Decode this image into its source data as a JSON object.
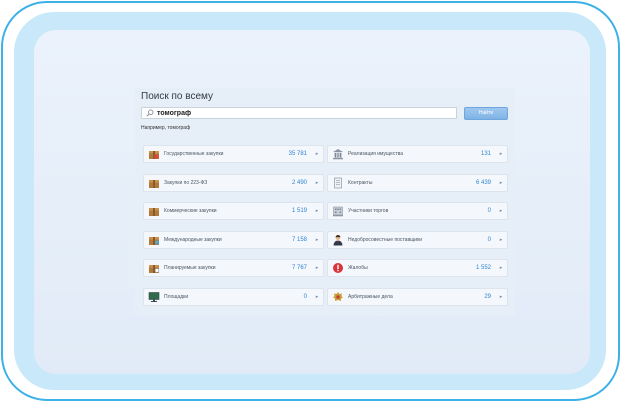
{
  "search": {
    "title": "Поиск по всему",
    "query": "томограф",
    "button_label": "Найти",
    "hint_prefix": "Например,",
    "hint_example": "томограф"
  },
  "categories": [
    {
      "label": "Государственные закупки",
      "count": "35 781",
      "icon": "box-icon"
    },
    {
      "label": "Реализация имущества",
      "count": "131",
      "icon": "building-icon"
    },
    {
      "label": "Закупки по 223-ФЗ",
      "count": "2 490",
      "icon": "box-icon"
    },
    {
      "label": "Контракты",
      "count": "6 439",
      "icon": "document-icon"
    },
    {
      "label": "Коммерческие закупки",
      "count": "1 519",
      "icon": "box-icon"
    },
    {
      "label": "Участники торгов",
      "count": "0",
      "icon": "building-icon"
    },
    {
      "label": "Международные закупки",
      "count": "7 158",
      "icon": "box-icon"
    },
    {
      "label": "Недобросовестные поставщики",
      "count": "0",
      "icon": "person-icon"
    },
    {
      "label": "Планируемые закупки",
      "count": "7 767",
      "icon": "box-icon"
    },
    {
      "label": "Жалобы",
      "count": "1 552",
      "icon": "alert-icon"
    },
    {
      "label": "Площадки",
      "count": "0",
      "icon": "monitor-icon"
    },
    {
      "label": "Арбитражные дела",
      "count": "29",
      "icon": "emblem-icon"
    }
  ],
  "colors": {
    "accent": "#2f86d4",
    "frame_border": "#3bb1e6",
    "button": "#8fbeec"
  }
}
